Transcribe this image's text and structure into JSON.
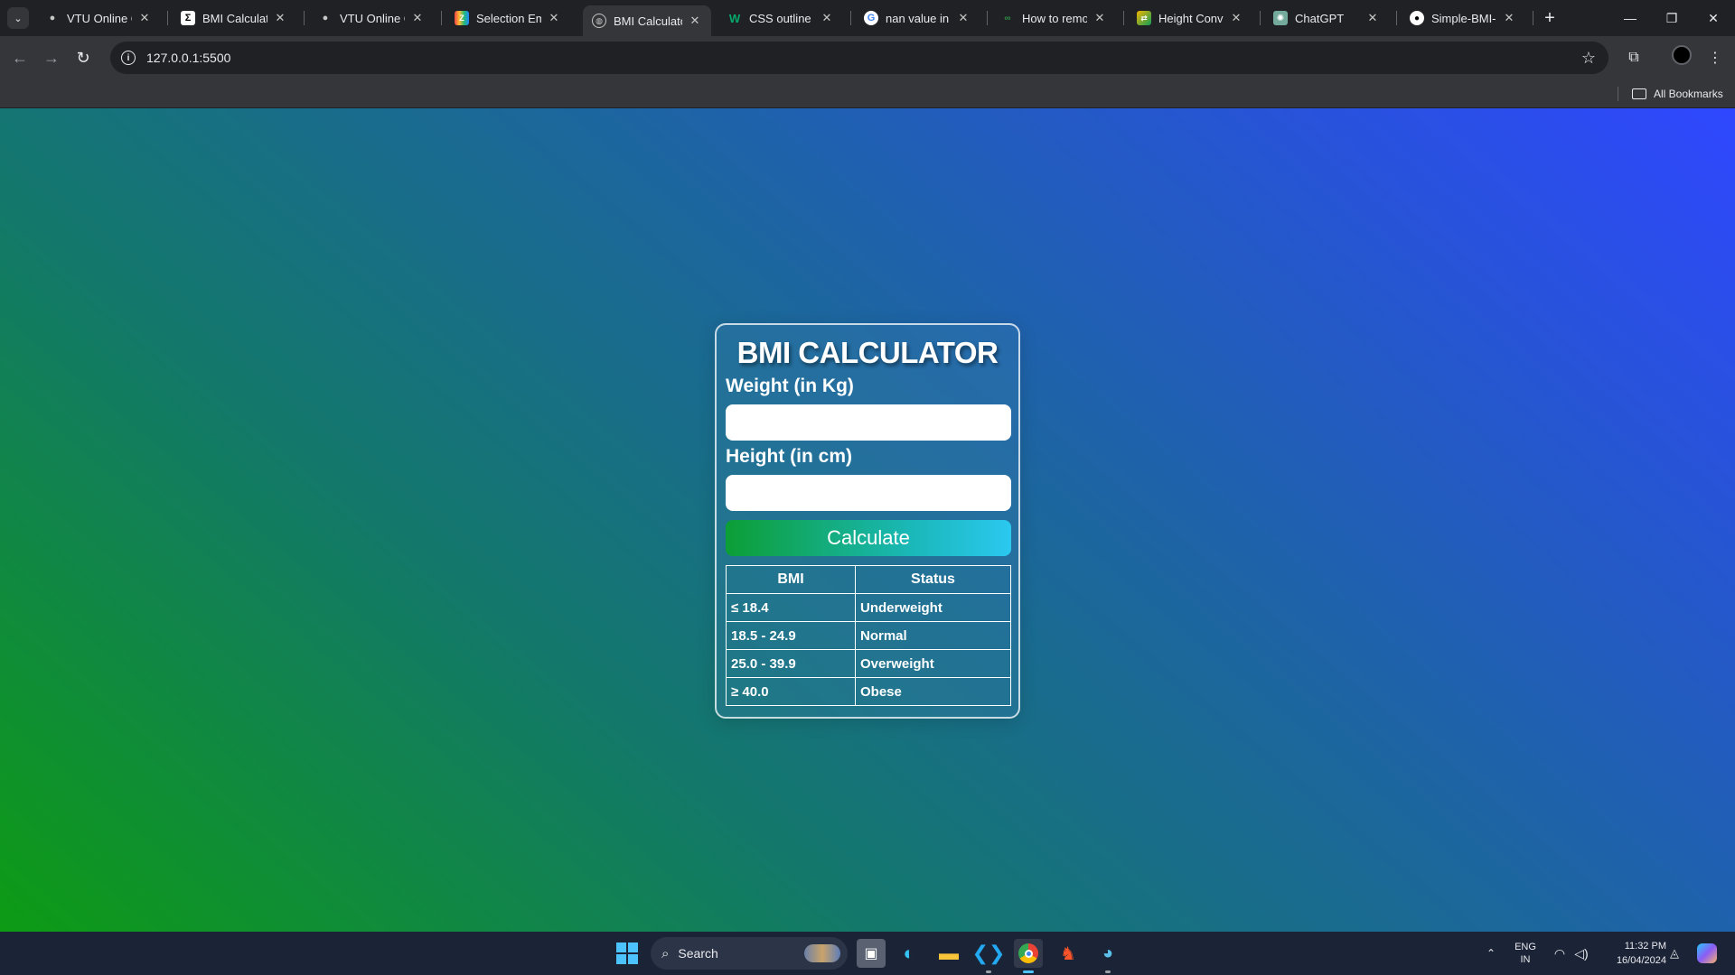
{
  "browser": {
    "tabs": [
      {
        "title": "VTU Online Cla",
        "favicon": "vtu-icon",
        "active": false
      },
      {
        "title": "BMI Calculator",
        "favicon": "sigma-icon",
        "active": false
      },
      {
        "title": "VTU Online Cla",
        "favicon": "vtu-icon",
        "active": false
      },
      {
        "title": "Selection Embe",
        "favicon": "zoho-icon",
        "active": false
      },
      {
        "title": "BMI Calculator",
        "favicon": "globe-icon",
        "active": true
      },
      {
        "title": "CSS outline Pro",
        "favicon": "w3schools-icon",
        "active": false
      },
      {
        "title": "nan value in ja",
        "favicon": "google-icon",
        "active": false
      },
      {
        "title": "How to remove",
        "favicon": "gfg-icon",
        "active": false
      },
      {
        "title": "Height Convert",
        "favicon": "converter-icon",
        "active": false
      },
      {
        "title": "ChatGPT",
        "favicon": "chatgpt-icon",
        "active": false
      },
      {
        "title": "Simple-BMI-Ca",
        "favicon": "github-icon",
        "active": false
      }
    ],
    "url": "127.0.0.1:5500",
    "bookmarks_label": "All Bookmarks"
  },
  "page": {
    "title": "BMI CALCULATOR",
    "weight_label": "Weight (in Kg)",
    "weight_value": "",
    "height_label": "Height (in cm)",
    "height_value": "",
    "calculate_label": "Calculate",
    "table": {
      "headers": [
        "BMI",
        "Status"
      ],
      "rows": [
        [
          "≤ 18.4",
          "Underweight"
        ],
        [
          "18.5 - 24.9",
          "Normal"
        ],
        [
          "25.0 - 39.9",
          "Overweight"
        ],
        [
          "≥ 40.0",
          "Obese"
        ]
      ]
    }
  },
  "taskbar": {
    "search_label": "Search",
    "lang_line1": "ENG",
    "lang_line2": "IN",
    "time": "11:32 PM",
    "date": "16/04/2024"
  }
}
